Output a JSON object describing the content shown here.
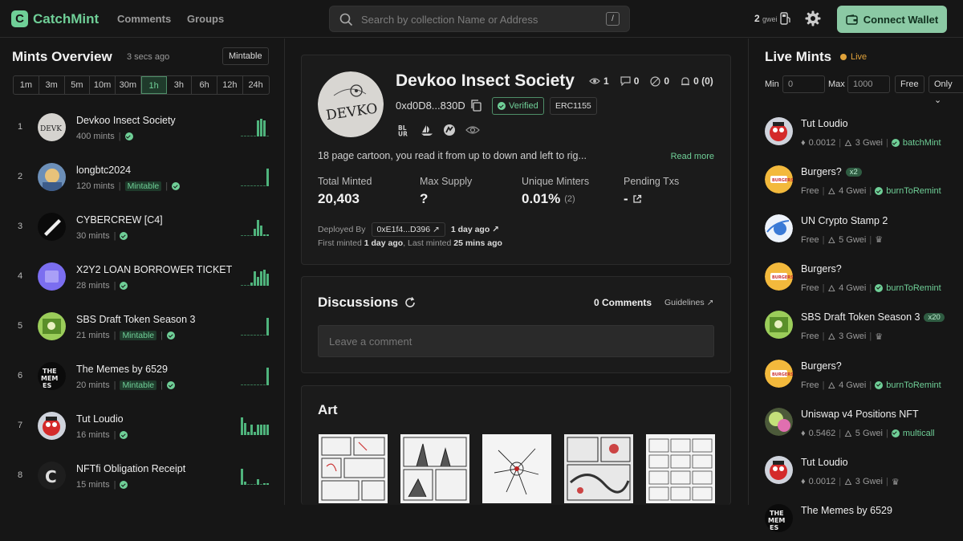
{
  "brand": {
    "name": "CatchMint",
    "logo_letter": "C",
    "accent": "#6fcf97"
  },
  "nav": {
    "comments": "Comments",
    "groups": "Groups"
  },
  "search": {
    "placeholder": "Search by collection Name or Address",
    "shortcut": "/"
  },
  "gas": {
    "value": "2",
    "unit": "gwei",
    "icon": "gas-pump-icon"
  },
  "wallet": {
    "label": "Connect Wallet"
  },
  "mints_overview": {
    "title": "Mints Overview",
    "updated": "3 secs ago",
    "mintable_label": "Mintable",
    "timeframes": [
      "1m",
      "3m",
      "5m",
      "10m",
      "30m",
      "1h",
      "3h",
      "6h",
      "12h",
      "24h"
    ],
    "active_timeframe": "1h",
    "rows": [
      {
        "rank": "1",
        "name": "Devkoo Insect Society",
        "mints": "400 mints",
        "mintable": null,
        "spark": [
          0,
          0,
          0,
          0,
          0,
          0.9,
          1,
          0.9,
          0
        ]
      },
      {
        "rank": "2",
        "name": "longbtc2024",
        "mints": "120 mints",
        "mintable": "Mintable",
        "spark": [
          0,
          0,
          0,
          0,
          0,
          0,
          0,
          0,
          1
        ]
      },
      {
        "rank": "3",
        "name": "CYBERCREW [C4]",
        "mints": "30 mints",
        "mintable": null,
        "spark": [
          0,
          0,
          0,
          0,
          0.4,
          0.9,
          0.6,
          0.1,
          0.1
        ]
      },
      {
        "rank": "4",
        "name": "X2Y2 LOAN BORROWER TICKET",
        "mints": "28 mints",
        "mintable": null,
        "spark": [
          0,
          0,
          0,
          0.2,
          0.8,
          0.5,
          0.8,
          0.9,
          0.7
        ]
      },
      {
        "rank": "5",
        "name": "SBS Draft Token Season 3",
        "mints": "21 mints",
        "mintable": "Mintable",
        "spark": [
          0,
          0,
          0,
          0,
          0,
          0,
          0,
          0,
          1
        ]
      },
      {
        "rank": "6",
        "name": "The Memes by 6529",
        "mints": "20 mints",
        "mintable": "Mintable",
        "spark": [
          0,
          0,
          0,
          0,
          0,
          0,
          0,
          0,
          1
        ]
      },
      {
        "rank": "7",
        "name": "Tut Loudio",
        "mints": "16 mints",
        "mintable": null,
        "spark": [
          1,
          0.7,
          0.2,
          0.6,
          0.2,
          0.6,
          0.6,
          0.6,
          0.6
        ]
      },
      {
        "rank": "8",
        "name": "NFTfi Obligation Receipt",
        "mints": "15 mints",
        "mintable": null,
        "spark": [
          0.9,
          0.2,
          0,
          0,
          0,
          0.3,
          0,
          0.1,
          0.1
        ]
      }
    ]
  },
  "collection": {
    "name": "Devkoo Insect Society",
    "address": "0xd0D8...830D",
    "verified": "Verified",
    "standard": "ERC1155",
    "views": "1",
    "comments": "0",
    "hidden": "0",
    "alerts": "0 (0)",
    "description": "18 page cartoon, you read it from up to down and left to rig...",
    "read_more": "Read more",
    "stats": [
      {
        "label": "Total Minted",
        "value": "20,403",
        "extra": ""
      },
      {
        "label": "Max Supply",
        "value": "?",
        "extra": ""
      },
      {
        "label": "Unique Minters",
        "value": "0.01%",
        "extra": "(2)"
      },
      {
        "label": "Pending Txs",
        "value": "-",
        "extra": ""
      }
    ],
    "deployed_by_label": "Deployed By",
    "deployer": "0xE1f4...D396",
    "deployed_ago": "1 day ago",
    "first_minted_label": "First minted",
    "first_minted": "1 day ago",
    "last_minted_label": "Last minted",
    "last_minted": "25 mins ago"
  },
  "discussions": {
    "title": "Discussions",
    "count": "0 Comments",
    "guidelines": "Guidelines",
    "placeholder": "Leave a comment"
  },
  "art": {
    "title": "Art"
  },
  "live_mints": {
    "title": "Live Mints",
    "status": "Live",
    "min_label": "Min",
    "min_value": "0",
    "max_label": "Max",
    "max_value": "1000",
    "free_label": "Free",
    "only_label": "Only",
    "rows": [
      {
        "name": "Tut Loudio",
        "multiplier": "",
        "price": "0.0012",
        "gas": "3 Gwei",
        "method": "batchMint"
      },
      {
        "name": "Burgers?",
        "multiplier": "x2",
        "price": "Free",
        "gas": "4 Gwei",
        "method": "burnToRemint"
      },
      {
        "name": "UN Crypto Stamp 2",
        "multiplier": "",
        "price": "Free",
        "gas": "5 Gwei",
        "method": ""
      },
      {
        "name": "Burgers?",
        "multiplier": "",
        "price": "Free",
        "gas": "4 Gwei",
        "method": "burnToRemint"
      },
      {
        "name": "SBS Draft Token Season 3",
        "multiplier": "x20",
        "price": "Free",
        "gas": "3 Gwei",
        "method": ""
      },
      {
        "name": "Burgers?",
        "multiplier": "",
        "price": "Free",
        "gas": "4 Gwei",
        "method": "burnToRemint"
      },
      {
        "name": "Uniswap v4 Positions NFT",
        "multiplier": "",
        "price": "0.5462",
        "gas": "5 Gwei",
        "method": "multicall"
      },
      {
        "name": "Tut Loudio",
        "multiplier": "",
        "price": "0.0012",
        "gas": "3 Gwei",
        "method": ""
      },
      {
        "name": "The Memes by 6529",
        "multiplier": "",
        "price": "",
        "gas": "",
        "method": ""
      }
    ]
  }
}
